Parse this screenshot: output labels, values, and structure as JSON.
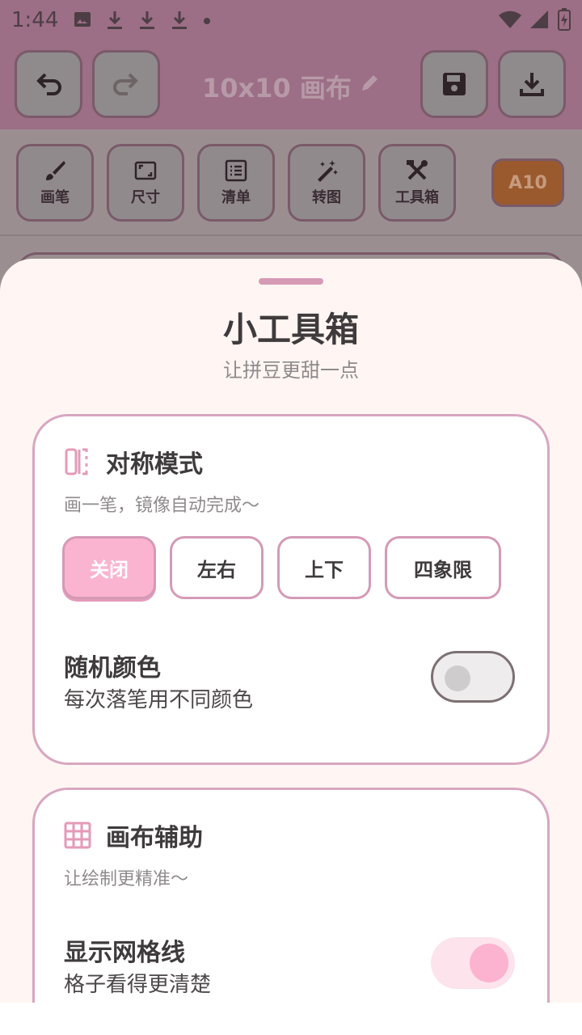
{
  "status_bar": {
    "time": "1:44",
    "icons": [
      "image-icon",
      "download-icon",
      "download-icon",
      "download-icon",
      "dot-icon",
      "wifi-icon",
      "signal-icon",
      "battery-charging-icon"
    ]
  },
  "app_bar": {
    "title": "10x10 画布",
    "buttons": [
      "undo-icon",
      "redo-icon",
      "save-icon",
      "download-icon"
    ]
  },
  "toolbar": {
    "items": [
      {
        "label": "画笔",
        "icon": "brush-icon"
      },
      {
        "label": "尺寸",
        "icon": "resize-icon"
      },
      {
        "label": "清单",
        "icon": "list-icon"
      },
      {
        "label": "转图",
        "icon": "magic-wand-icon"
      },
      {
        "label": "工具箱",
        "icon": "tools-icon"
      }
    ],
    "color_badge": "A10",
    "color_badge_hex": "#9a5a2e"
  },
  "sheet": {
    "title": "小工具箱",
    "subtitle": "让拼豆更甜一点",
    "symmetry": {
      "title": "对称模式",
      "desc": "画一笔，镜像自动完成～",
      "options": [
        "关闭",
        "左右",
        "上下",
        "四象限"
      ],
      "selected": "关闭"
    },
    "random_color": {
      "title": "随机颜色",
      "desc": "每次落笔用不同颜色",
      "enabled": false
    },
    "canvas_assist": {
      "title": "画布辅助",
      "desc": "让绘制更精准～"
    },
    "grid_lines": {
      "title": "显示网格线",
      "desc": "格子看得更清楚",
      "enabled": true
    }
  },
  "colors": {
    "accent_pink": "#fbb4cf",
    "card_border": "#d8a6c0",
    "sheet_bg": "#fff6f3"
  }
}
